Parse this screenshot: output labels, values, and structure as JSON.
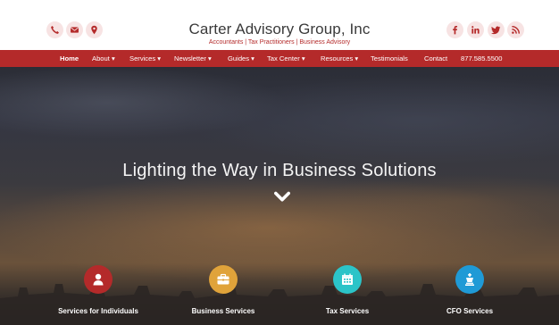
{
  "header": {
    "title": "Carter Advisory Group, Inc",
    "subtitle": "Accountants | Tax Practitioners | Business Advisory",
    "contact_icons": [
      "phone-icon",
      "envelope-icon",
      "map-marker-icon"
    ],
    "social_icons": [
      "facebook-icon",
      "linkedin-icon",
      "twitter-icon",
      "rss-icon"
    ]
  },
  "nav": {
    "home": "Home",
    "about": "About ▾",
    "services": "Services ▾",
    "newsletter": "Newsletter ▾",
    "guides": "Guides ▾",
    "tax_center": "Tax Center ▾",
    "resources": "Resources ▾",
    "testimonials": "Testimonials",
    "contact": "Contact",
    "phone": "877.585.5500"
  },
  "hero": {
    "headline": "Lighting the Way in Business Solutions",
    "chevron_icon": "chevron-down-icon"
  },
  "services": [
    {
      "label": "Services for Individuals",
      "icon": "user-icon",
      "color": "#b42a2a"
    },
    {
      "label": "Business Services",
      "icon": "briefcase-icon",
      "color": "#e0a33a"
    },
    {
      "label": "Tax Services",
      "icon": "calendar-icon",
      "color": "#2bc4c8"
    },
    {
      "label": "CFO Services",
      "icon": "chess-king-icon",
      "color": "#1f9ad6"
    }
  ],
  "colors": {
    "accent": "#b42a2a",
    "icon_bg": "#f7e3e3"
  }
}
